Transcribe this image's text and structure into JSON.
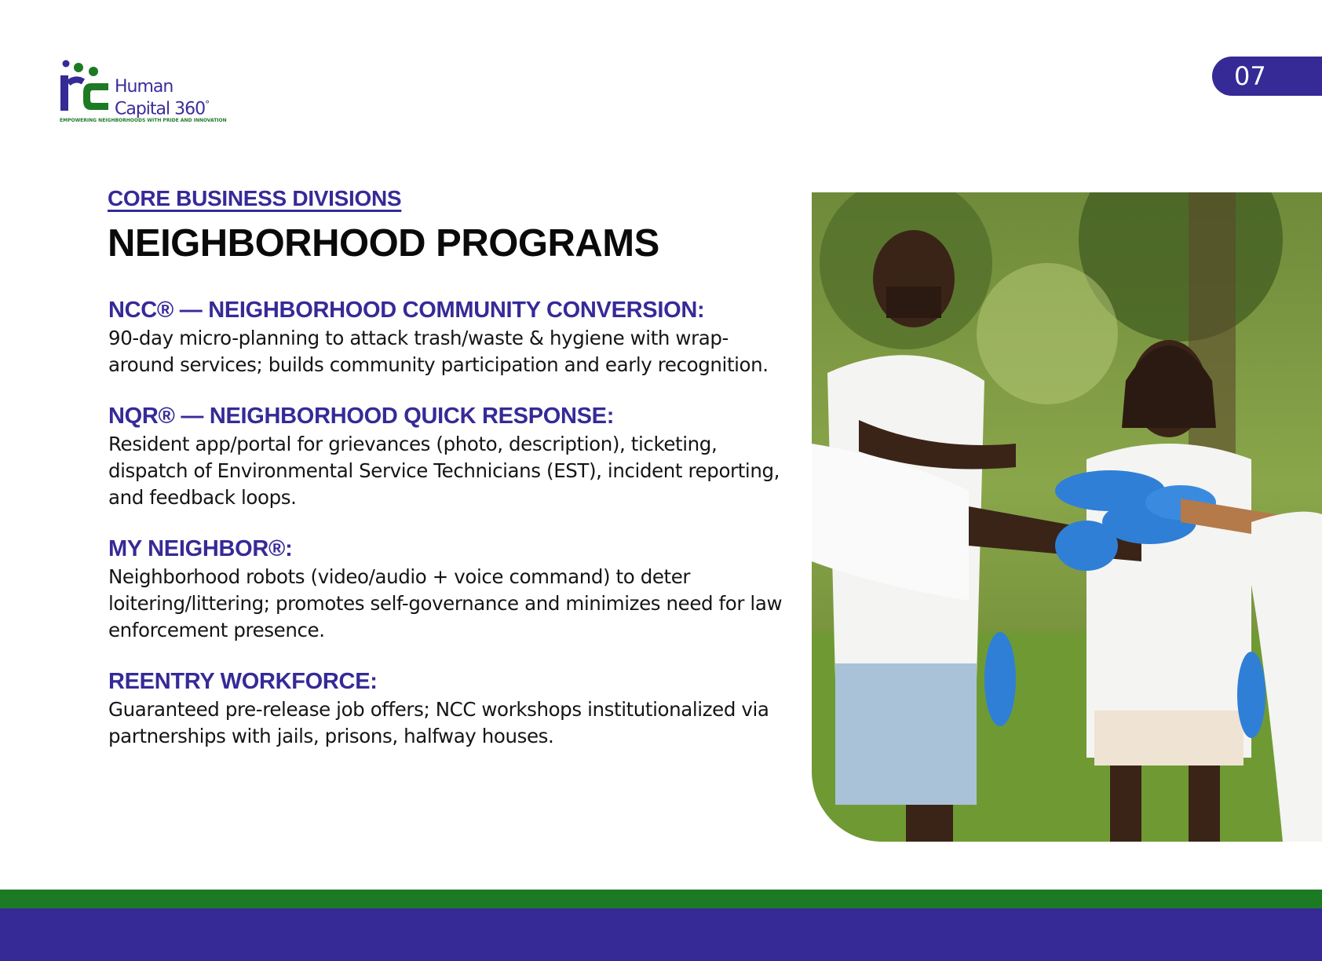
{
  "logo": {
    "name_line1": "Human",
    "name_line2": "Capital 360",
    "degree_mark": "°",
    "tagline": "EMPOWERING NEIGHBORHOODS WITH PRIDE AND INNOVATION",
    "icon": "hc-monogram-logo-icon"
  },
  "page_number": "07",
  "eyebrow": "CORE BUSINESS DIVISIONS",
  "title": "NEIGHBORHOOD PROGRAMS",
  "programs": [
    {
      "heading": "NCC® — NEIGHBORHOOD COMMUNITY CONVERSION:",
      "description": "90-day micro-planning to attack trash/waste & hygiene with wrap-around services; builds community participation and early recognition."
    },
    {
      "heading": "NQR® — NEIGHBORHOOD QUICK RESPONSE:",
      "description": "Resident app/portal for grievances (photo, description), ticketing, dispatch of Environmental Service Technicians (EST), incident reporting, and feedback loops."
    },
    {
      "heading": "MY NEIGHBOR®:",
      "description": "Neighborhood robots (video/audio + voice command) to deter loitering/littering; promotes self-governance and minimizes need for law enforcement presence."
    },
    {
      "heading": "REENTRY WORKFORCE:",
      "description": "Guaranteed pre-release job offers; NCC workshops institutionalized via partnerships with jails, prisons, halfway houses."
    }
  ],
  "photo": {
    "icon": "volunteers-hands-together-photo"
  },
  "colors": {
    "brand_purple": "#362a97",
    "brand_green": "#1d7a24",
    "title_black": "#0a0a0a"
  }
}
